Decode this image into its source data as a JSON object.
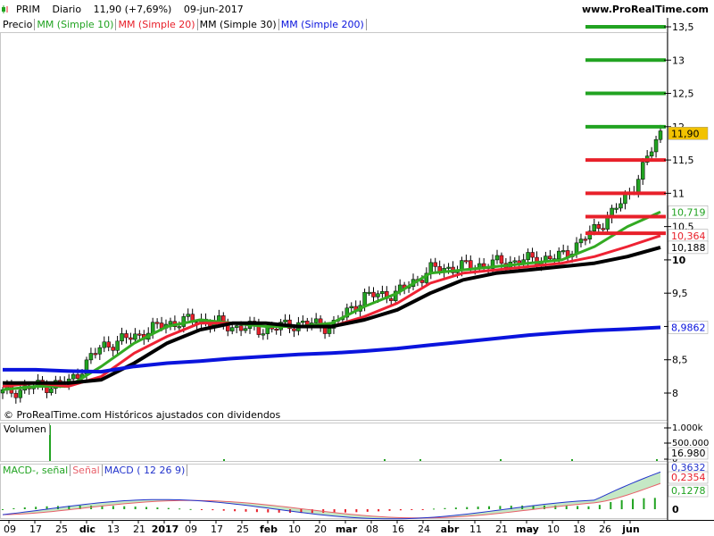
{
  "header": {
    "symbol": "PRIM",
    "period": "Diario",
    "price": "11,90 (+7,69%)",
    "date": "09-jun-2017",
    "site": "www.ProRealTime.com"
  },
  "legend": {
    "price": "Precio",
    "ma10": "MM (Simple 10)",
    "ma20": "MM (Simple 20)",
    "ma30": "MM (Simple 30)",
    "ma200": "MM (Simple 200)"
  },
  "colors": {
    "up": "#21a321",
    "down": "#e8202a",
    "ma10": "#33aa22",
    "ma20": "#ee2233",
    "ma30": "#000000",
    "ma200": "#0a14dd",
    "macd_line": "#2233cc",
    "signal_line": "#e8606a"
  },
  "copyright": "© ProRealTime.com Históricos ajustados con dividendos",
  "volume_panel": {
    "label": "Volumen",
    "scale": [
      "1.000k",
      "500.000",
      "0"
    ],
    "last": "16.980"
  },
  "macd_panel": {
    "label_macd_minus_signal": "MACD-, señal",
    "label_signal": "Señal",
    "label_macd": "MACD ( 12 26 9)",
    "scale_zero": "0",
    "values": [
      "0,3632",
      "0,2354",
      "0,1278"
    ]
  },
  "price_scale": [
    "13,5",
    "13",
    "12,5",
    "12",
    "11,5",
    "11",
    "10,5",
    "10",
    "9,5",
    "9",
    "8,5",
    "8"
  ],
  "price_tags": [
    {
      "text": "11,90",
      "bg": "#f2c200",
      "fg": "#000000"
    },
    {
      "text": "10,719",
      "bg": "#ffffff",
      "fg": "#21a321"
    },
    {
      "text": "10,364",
      "bg": "#ffffff",
      "fg": "#e8202a"
    },
    {
      "text": "10,188",
      "bg": "#ffffff",
      "fg": "#000000"
    },
    {
      "text": "8,9862",
      "bg": "#ffffff",
      "fg": "#0a14dd"
    }
  ],
  "x_labels": [
    "09",
    "17",
    "25",
    "dic",
    "13",
    "21",
    "2017",
    "09",
    "17",
    "25",
    "feb",
    "10",
    "20",
    "mar",
    "08",
    "16",
    "24",
    "abr",
    "11",
    "21",
    "may",
    "10",
    "18",
    "26",
    "jun"
  ],
  "chart_data": {
    "type": "line",
    "title": "PRIM Diario",
    "ylim": [
      7.75,
      13.6
    ],
    "x": [
      "2016-11-07",
      "2016-11-17",
      "2016-11-28",
      "2016-12-05",
      "2016-12-20",
      "2017-01-02",
      "2017-01-16",
      "2017-02-01",
      "2017-02-15",
      "2017-03-01",
      "2017-03-07",
      "2017-03-15",
      "2017-03-24",
      "2017-04-04",
      "2017-04-18",
      "2017-05-02",
      "2017-05-16",
      "2017-05-26",
      "2017-06-01",
      "2017-06-06",
      "2017-06-09"
    ],
    "series": [
      {
        "name": "Precio",
        "values": [
          8.0,
          8.1,
          8.15,
          8.7,
          8.85,
          9.05,
          9.1,
          9.0,
          8.95,
          9.05,
          9.0,
          9.45,
          9.5,
          9.85,
          9.9,
          9.95,
          10.0,
          10.05,
          10.45,
          10.95,
          11.9
        ]
      },
      {
        "name": "MM (Simple 10)",
        "values": [
          8.05,
          8.1,
          8.1,
          8.4,
          8.75,
          9.0,
          9.1,
          9.05,
          9.0,
          9.0,
          9.05,
          9.3,
          9.5,
          9.8,
          9.85,
          9.9,
          9.95,
          10.0,
          10.2,
          10.5,
          10.719
        ]
      },
      {
        "name": "MM (Simple 20)",
        "values": [
          8.1,
          8.15,
          8.1,
          8.25,
          8.6,
          8.85,
          9.05,
          9.05,
          9.05,
          9.0,
          9.0,
          9.15,
          9.35,
          9.65,
          9.8,
          9.85,
          9.9,
          9.95,
          10.05,
          10.2,
          10.364
        ]
      },
      {
        "name": "MM (Simple 30)",
        "values": [
          8.15,
          8.15,
          8.15,
          8.2,
          8.45,
          8.75,
          8.95,
          9.05,
          9.05,
          9.0,
          9.0,
          9.1,
          9.25,
          9.5,
          9.7,
          9.8,
          9.85,
          9.9,
          9.95,
          10.05,
          10.188
        ]
      },
      {
        "name": "MM (Simple 200)",
        "values": [
          8.35,
          8.35,
          8.33,
          8.32,
          8.4,
          8.45,
          8.48,
          8.52,
          8.55,
          8.58,
          8.6,
          8.63,
          8.67,
          8.72,
          8.77,
          8.82,
          8.87,
          8.91,
          8.94,
          8.96,
          8.9862
        ]
      }
    ],
    "levels_green": [
      13.5,
      13.0,
      12.5,
      12.0
    ],
    "levels_red": [
      11.5,
      11.0,
      10.65,
      10.4
    ],
    "volume_max": 1000000,
    "volume_last": 16980,
    "macd": {
      "macd": 0.3632,
      "signal": 0.2354,
      "hist": 0.1278
    }
  }
}
